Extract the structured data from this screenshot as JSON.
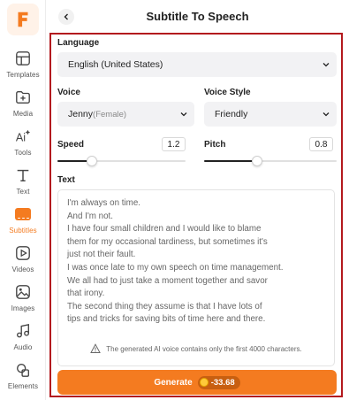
{
  "header": {
    "title": "Subtitle To Speech"
  },
  "sidebar": {
    "items": [
      {
        "label": "Templates",
        "icon": "templates-icon"
      },
      {
        "label": "Media",
        "icon": "media-icon"
      },
      {
        "label": "Tools",
        "icon": "ai-tools-icon"
      },
      {
        "label": "Text",
        "icon": "text-icon"
      },
      {
        "label": "Subtitles",
        "icon": "subtitles-icon",
        "active": true
      },
      {
        "label": "Videos",
        "icon": "videos-icon"
      },
      {
        "label": "Images",
        "icon": "images-icon"
      },
      {
        "label": "Audio",
        "icon": "audio-icon"
      },
      {
        "label": "Elements",
        "icon": "elements-icon"
      }
    ]
  },
  "form": {
    "language_label": "Language",
    "language_value": "English (United States)",
    "voice_label": "Voice",
    "voice_name": "Jenny",
    "voice_gender": "(Female)",
    "voice_style_label": "Voice Style",
    "voice_style_value": "Friendly",
    "speed_label": "Speed",
    "speed_value": "1.2",
    "speed_fraction": 0.27,
    "pitch_label": "Pitch",
    "pitch_value": "0.8",
    "pitch_fraction": 0.4,
    "text_label": "Text",
    "text_lines": [
      "I'm always on time.",
      "And I'm not.",
      "I have four small children and I would like to blame",
      "them for my occasional tardiness, but sometimes it's",
      "just not their fault.",
      "I was once late to my own speech on time management.",
      "We all had to just take a moment together and savor",
      "that irony.",
      "The second thing they assume is that I have lots of",
      "tips and tricks for saving bits of time here and there."
    ],
    "notice": "The generated AI voice contains only the first 4000 characters.",
    "generate_label": "Generate",
    "generate_cost": "-33.68"
  },
  "colors": {
    "accent": "#f47b20",
    "highlight_border": "#b3191e"
  }
}
